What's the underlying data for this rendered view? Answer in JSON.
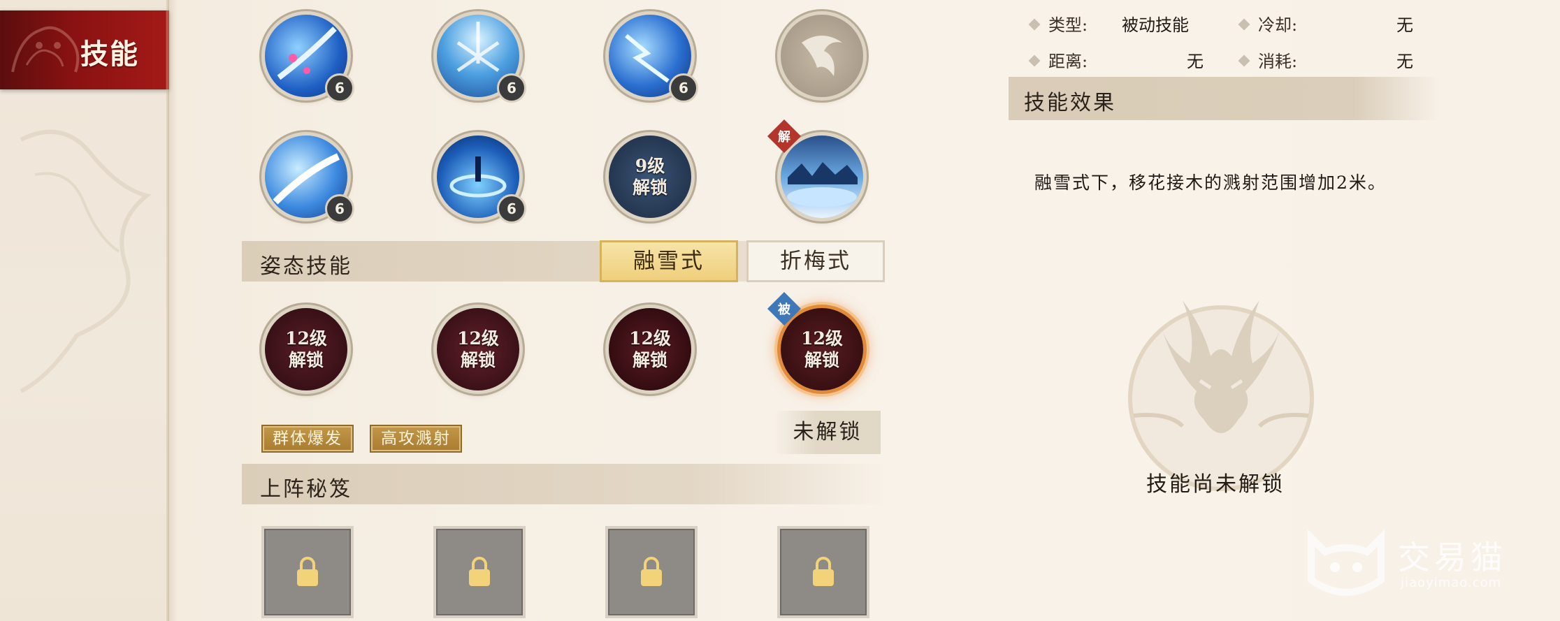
{
  "sidebar": {
    "active_tab_label": "技能"
  },
  "skills_row1": [
    {
      "level": "6"
    },
    {
      "level": "6"
    },
    {
      "level": "6"
    },
    {
      "level": ""
    }
  ],
  "skills_row2": [
    {
      "level": "6"
    },
    {
      "level": "6"
    },
    {
      "lock_line1": "9级",
      "lock_line2": "解锁"
    },
    {
      "corner_tag": "解"
    }
  ],
  "stance": {
    "title": "姿态技能",
    "options": [
      "融雪式",
      "折梅式"
    ],
    "active": "融雪式"
  },
  "stance_skills": [
    {
      "lock_line1": "12级",
      "lock_line2": "解锁"
    },
    {
      "lock_line1": "12级",
      "lock_line2": "解锁"
    },
    {
      "lock_line1": "12级",
      "lock_line2": "解锁"
    },
    {
      "lock_line1": "12级",
      "lock_line2": "解锁",
      "corner_tag": "被"
    }
  ],
  "tags": [
    "群体爆发",
    "高攻溅射"
  ],
  "unlock_status": "未解锁",
  "formation": {
    "title": "上阵秘笈",
    "slots": 4
  },
  "detail": {
    "type_label": "类型:",
    "type_value": "被动技能",
    "cooldown_label": "冷却:",
    "cooldown_value": "无",
    "range_label": "距离:",
    "range_value": "无",
    "cost_label": "消耗:",
    "cost_value": "无",
    "effect_title": "技能效果",
    "effect_text": "融雪式下，移花接木的溅射范围增加2米。",
    "locked_caption": "技能尚未解锁"
  },
  "watermark": {
    "brand": "交易猫",
    "url": "jiaoyimao.com"
  },
  "colors": {
    "accent_red": "#a21a17",
    "active_gold": "#efcf7c",
    "slot_gray": "#8e8a85"
  }
}
